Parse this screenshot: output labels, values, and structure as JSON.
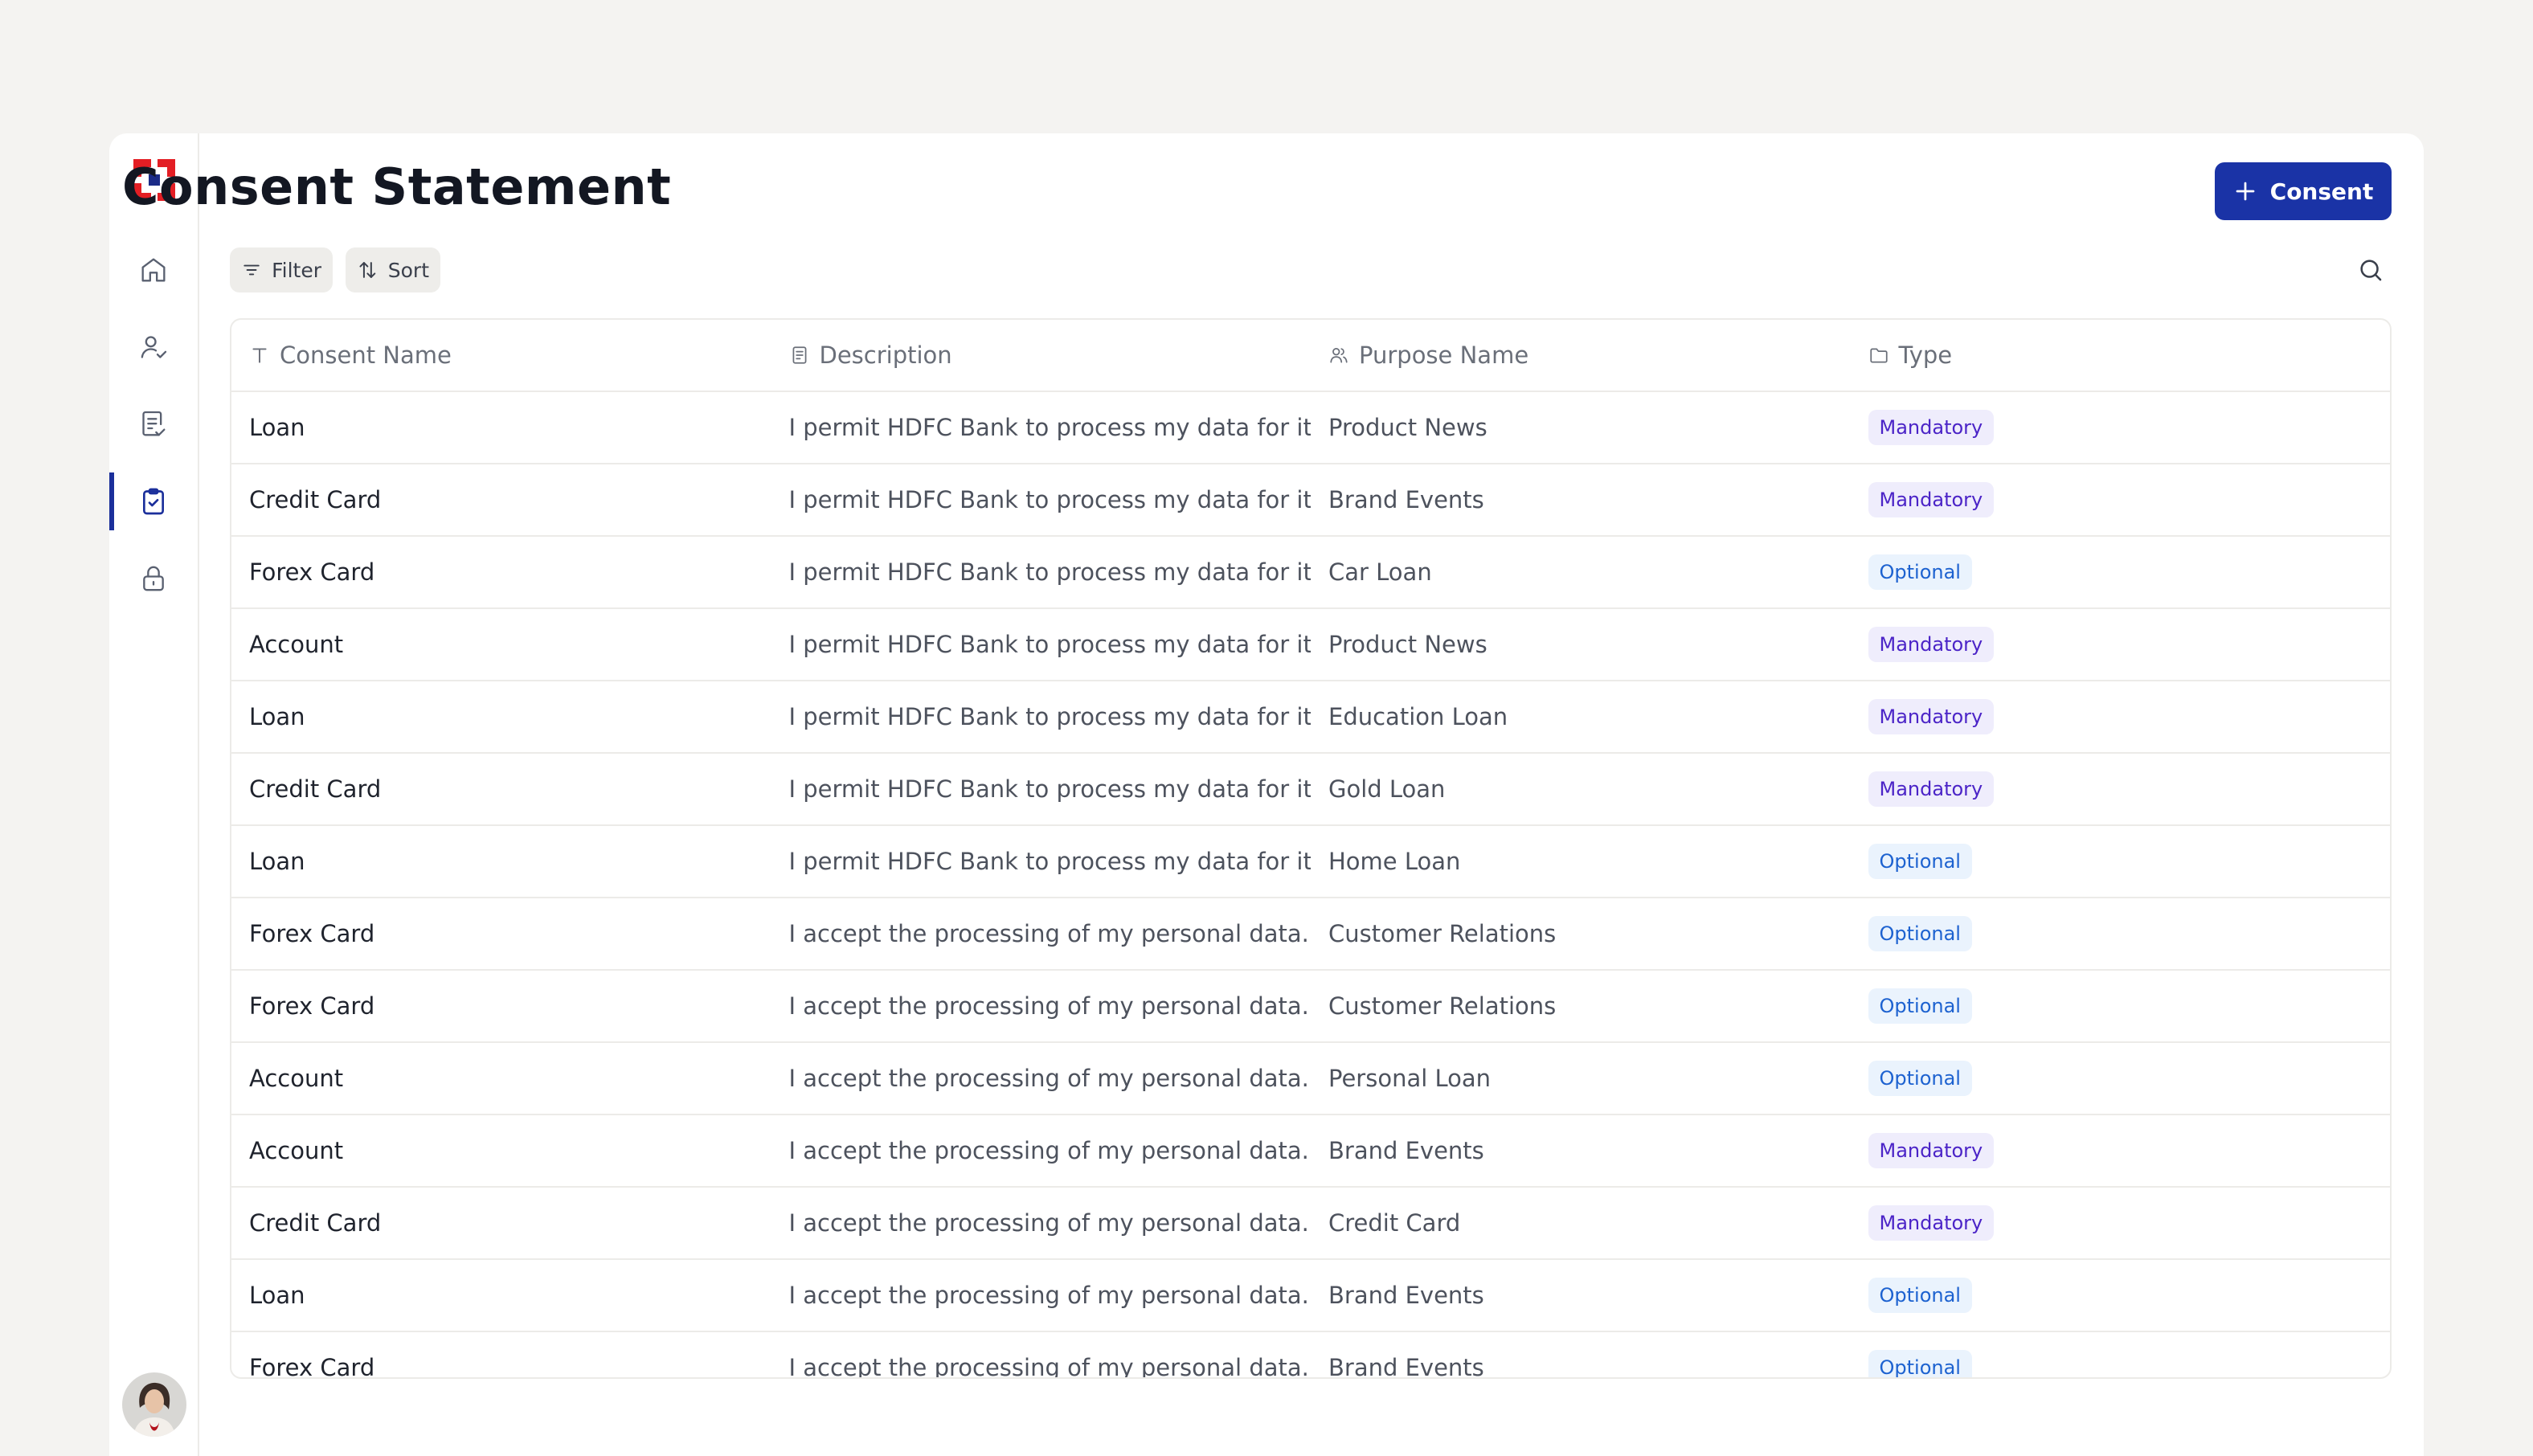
{
  "page": {
    "title": "Consent Statement"
  },
  "toolbar": {
    "add_label": "Consent",
    "filter_label": "Filter",
    "sort_label": "Sort"
  },
  "sidebar": {
    "items": [
      {
        "name": "home",
        "icon": "home-icon",
        "active": false
      },
      {
        "name": "users",
        "icon": "user-check-icon",
        "active": false
      },
      {
        "name": "documents",
        "icon": "document-check-icon",
        "active": false
      },
      {
        "name": "consents",
        "icon": "clipboard-check-icon",
        "active": true
      },
      {
        "name": "security",
        "icon": "lock-icon",
        "active": false
      }
    ]
  },
  "colors": {
    "accent": "#1a33a6",
    "brand_red": "#e31e24",
    "brand_blue": "#1b2b87",
    "mandatory": "#4b24c7",
    "optional": "#1d62d0"
  },
  "table": {
    "columns": [
      {
        "label": "Consent Name",
        "icon": "text-type-icon"
      },
      {
        "label": "Description",
        "icon": "document-icon"
      },
      {
        "label": "Purpose Name",
        "icon": "user-group-icon"
      },
      {
        "label": "Type",
        "icon": "folder-icon"
      }
    ],
    "rows": [
      {
        "name": "Loan",
        "description": "I permit HDFC Bank to process my data for it...",
        "purpose": "Product  News",
        "type": "Mandatory"
      },
      {
        "name": "Credit Card",
        "description": "I permit HDFC Bank to process my data for it...",
        "purpose": "Brand Events",
        "type": "Mandatory"
      },
      {
        "name": "Forex Card",
        "description": "I permit HDFC Bank to process my data for it...",
        "purpose": "Car Loan",
        "type": "Optional"
      },
      {
        "name": "Account",
        "description": "I permit HDFC Bank to process my data for it...",
        "purpose": "Product  News",
        "type": "Mandatory"
      },
      {
        "name": "Loan",
        "description": "I permit HDFC Bank to process my data for it...",
        "purpose": "Education Loan",
        "type": "Mandatory"
      },
      {
        "name": "Credit Card",
        "description": "I permit HDFC Bank to process my data for it...",
        "purpose": "Gold Loan",
        "type": "Mandatory"
      },
      {
        "name": "Loan",
        "description": "I permit HDFC Bank to process my data for it...",
        "purpose": "Home Loan",
        "type": "Optional"
      },
      {
        "name": "Forex Card",
        "description": "I accept the processing of my personal data.",
        "purpose": "Customer Relations",
        "type": "Optional"
      },
      {
        "name": "Forex Card",
        "description": "I accept the processing of my personal data.",
        "purpose": "Customer Relations",
        "type": "Optional"
      },
      {
        "name": "Account",
        "description": "I accept the processing of my personal data.",
        "purpose": "Personal Loan",
        "type": "Optional"
      },
      {
        "name": "Account",
        "description": "I accept the processing of my personal data.",
        "purpose": "Brand Events",
        "type": "Mandatory"
      },
      {
        "name": "Credit Card",
        "description": "I accept the processing of my personal data.",
        "purpose": "Credit Card",
        "type": "Mandatory"
      },
      {
        "name": "Loan",
        "description": "I accept the processing of my personal data.",
        "purpose": "Brand Events",
        "type": "Optional"
      },
      {
        "name": "Forex Card",
        "description": "I accept the processing of my personal data.",
        "purpose": "Brand Events",
        "type": "Optional"
      }
    ]
  }
}
